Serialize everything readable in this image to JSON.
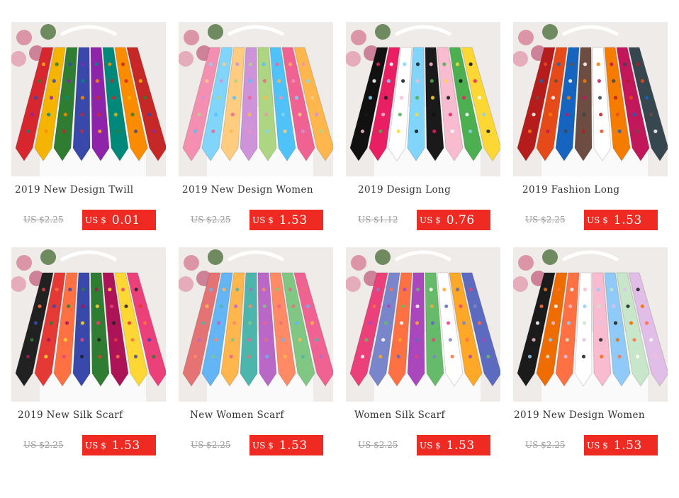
{
  "products": [
    {
      "title": "2019 New Design Twill",
      "old_price": "US $2.25",
      "currency": "US $",
      "price": "0.01",
      "colors": [
        "#d7262e",
        "#f4b400",
        "#2e7d32",
        "#3949ab",
        "#8e24aa",
        "#00897b",
        "#fb8c00",
        "#c62828"
      ]
    },
    {
      "title": "2019 New Design Women",
      "old_price": "US $2.25",
      "currency": "US $",
      "price": "1.53",
      "colors": [
        "#f48fb1",
        "#81d4fa",
        "#ffcc80",
        "#ce93d8",
        "#aed581",
        "#4fc3f7",
        "#f06292",
        "#ffb74d"
      ]
    },
    {
      "title": "2019 Design Long",
      "old_price": "US $1.12",
      "currency": "US $",
      "price": "0.76",
      "colors": [
        "#111111",
        "#e91e63",
        "#ffffff",
        "#81d4fa",
        "#1a1a1a",
        "#f8bbd0",
        "#4caf50",
        "#fdd835"
      ]
    },
    {
      "title": "2019 Fashion Long",
      "old_price": "US $2.25",
      "currency": "US $",
      "price": "1.53",
      "colors": [
        "#b71c1c",
        "#e64a19",
        "#1565c0",
        "#6d4c41",
        "#ffffff",
        "#f57c00",
        "#c2185b",
        "#37474f"
      ]
    },
    {
      "title": "2019 New Silk Scarf",
      "old_price": "US $2.25",
      "currency": "US $",
      "price": "1.53",
      "colors": [
        "#212121",
        "#e53935",
        "#ff7043",
        "#3949ab",
        "#2e7d32",
        "#ad1457",
        "#fdd835",
        "#ec407a"
      ]
    },
    {
      "title": "New Women Scarf",
      "old_price": "US $2.25",
      "currency": "US $",
      "price": "1.53",
      "colors": [
        "#e57373",
        "#64b5f6",
        "#ffb74d",
        "#4db6ac",
        "#ba68c8",
        "#ff8a65",
        "#81c784",
        "#f06292"
      ]
    },
    {
      "title": "Women Silk Scarf",
      "old_price": "US $2.25",
      "currency": "US $",
      "price": "1.53",
      "colors": [
        "#ec407a",
        "#7986cb",
        "#ff7043",
        "#ab47bc",
        "#66bb6a",
        "#ffffff",
        "#ffa726",
        "#5c6bc0"
      ]
    },
    {
      "title": "2019 New Design Women",
      "old_price": "US $2.25",
      "currency": "US $",
      "price": "1.53",
      "colors": [
        "#1b1b1b",
        "#ef6c00",
        "#ff7043",
        "#ffffff",
        "#f8bbd0",
        "#90caf9",
        "#c8e6c9",
        "#e1bee7"
      ]
    }
  ]
}
